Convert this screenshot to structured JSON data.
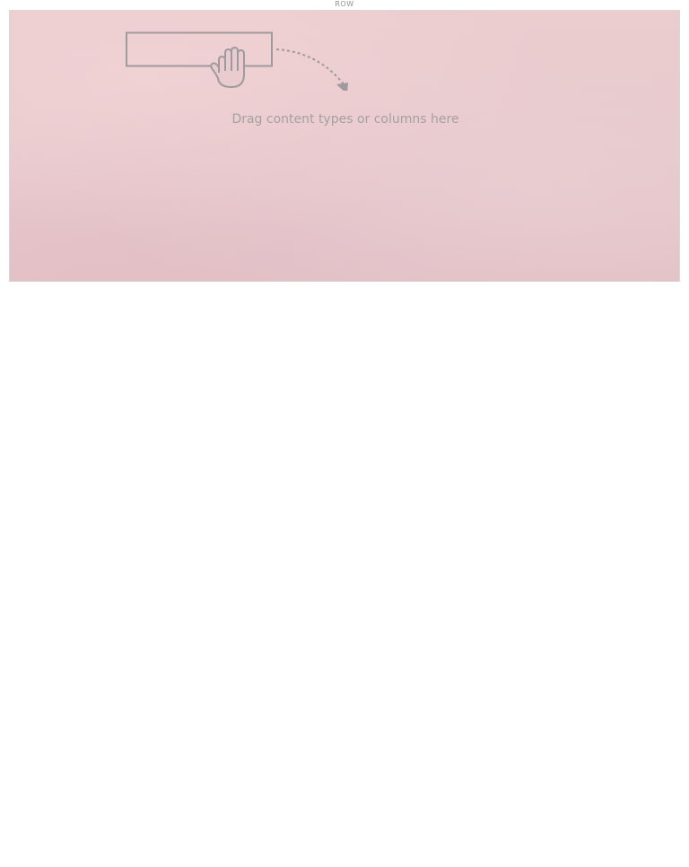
{
  "row": {
    "label": "ROW"
  },
  "dropzone": {
    "hint_text": "Drag content types or columns here",
    "illustration_icon": "drag-hand-icon",
    "illustration_color": "#9f9a9b",
    "background_color": "#e8c9cd"
  }
}
